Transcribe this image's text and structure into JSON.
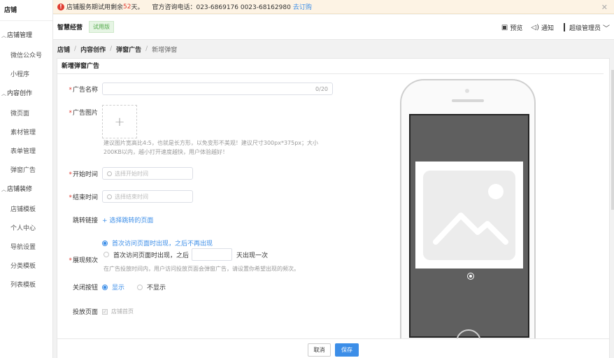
{
  "sidebar": {
    "brand": "店铺",
    "groups": [
      {
        "label": "店铺管理",
        "items": [
          "微信公众号",
          "小程序"
        ]
      },
      {
        "label": "内容创作",
        "items": [
          "微页面",
          "素材管理",
          "表单管理",
          "弹窗广告"
        ]
      },
      {
        "label": "店铺装修",
        "items": [
          "店铺模板",
          "个人中心",
          "导航设置",
          "分类模板",
          "列表模板"
        ]
      }
    ]
  },
  "notice": {
    "prefix": "店铺服务期试用剩余",
    "days": "52",
    "suffix": "天。",
    "hotline": "官方咨询电话：023-6869176 0023-68162980",
    "link": "去订购"
  },
  "header": {
    "title": "智慧经营",
    "badge": "试用版",
    "preview": "预览",
    "notify": "通知",
    "user": "超级管理员"
  },
  "breadcrumb": {
    "items": [
      "店铺",
      "内容创作",
      "弹窗广告"
    ],
    "current": "新增弹窗"
  },
  "form": {
    "title": "新增弹窗广告",
    "name_label": "广告名称",
    "name_count": "0/20",
    "image_label": "广告图片",
    "image_hint": "建议图片宽高比4:5，也就是长方形，以免变形不美观！建议尺寸300px*375px；大小200KB以内，越小打开速度越快，用户体验越好！",
    "start_label": "开始时间",
    "start_placeholder": "选择开始时间",
    "end_label": "结束时间",
    "end_placeholder": "选择结束时间",
    "jump_label": "跳转链接",
    "jump_action": "+ 选择跳转的页面",
    "freq_label": "展现频次",
    "freq_opt1": "首次访问页面时出现，之后不再出现",
    "freq_opt2_prefix": "首次访问页面时出现，之后",
    "freq_opt2_suffix": "天出现一次",
    "freq_hint": "在广告投放时间内，用户访问投放页面会弹窗广告，请设置你希望出现的频次。",
    "close_label": "关闭按钮",
    "close_show": "显示",
    "close_hide": "不显示",
    "page_label": "投放页面",
    "page_value": "店铺首页"
  },
  "footer": {
    "cancel": "取消",
    "save": "保存"
  }
}
